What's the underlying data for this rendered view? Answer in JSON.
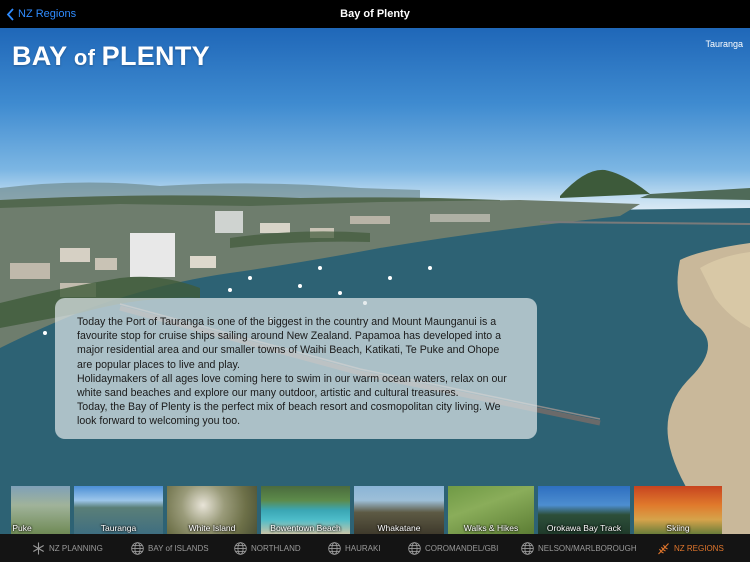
{
  "nav": {
    "back_label": "NZ Regions",
    "title": "Bay of Plenty"
  },
  "hero": {
    "heading_part1": "BAY",
    "heading_part2": " of ",
    "heading_part3": "PLENTY",
    "location_tag": "Tauranga"
  },
  "description": {
    "para1": "Today the Port of Tauranga is one of the biggest in the country and Mount Maunganui is a favourite stop for cruise ships sailing around New Zealand. Papamoa has developed into a major residential area and our smaller towns of Waihi Beach, Katikati, Te Puke and Ohope are popular places to live and play.",
    "para2": "Holidaymakers of all ages love coming here to swim in our warm ocean waters, relax on our white sand beaches and explore our many outdoor, artistic and cultural treasures.",
    "para3": "Today, the Bay of Plenty is the perfect mix of beach resort and cosmopolitan city living. We look forward to welcoming you too."
  },
  "thumbnails": [
    {
      "label": "Te Puke"
    },
    {
      "label": "Tauranga"
    },
    {
      "label": "White Island"
    },
    {
      "label": "Bowentown Beach"
    },
    {
      "label": "Whakatane"
    },
    {
      "label": "Walks & Hikes"
    },
    {
      "label": "Orokawa Bay Track"
    },
    {
      "label": "Skiing"
    }
  ],
  "tabs": [
    {
      "label": "NZ PLANNING",
      "icon": "snowflake-icon"
    },
    {
      "label": "BAY of ISLANDS",
      "icon": "globe-icon"
    },
    {
      "label": "NORTHLAND",
      "icon": "globe-icon"
    },
    {
      "label": "HAURAKI",
      "icon": "globe-icon"
    },
    {
      "label": "COROMANDEL/GBI",
      "icon": "globe-icon"
    },
    {
      "label": "NELSON/MARLBOROUGH",
      "icon": "globe-icon"
    },
    {
      "label": "NZ REGIONS",
      "icon": "fern-icon"
    }
  ],
  "colors": {
    "accent_blue": "#2f8cff",
    "active_tab": "#e0762c",
    "tab_inactive": "#9a9a9a"
  }
}
